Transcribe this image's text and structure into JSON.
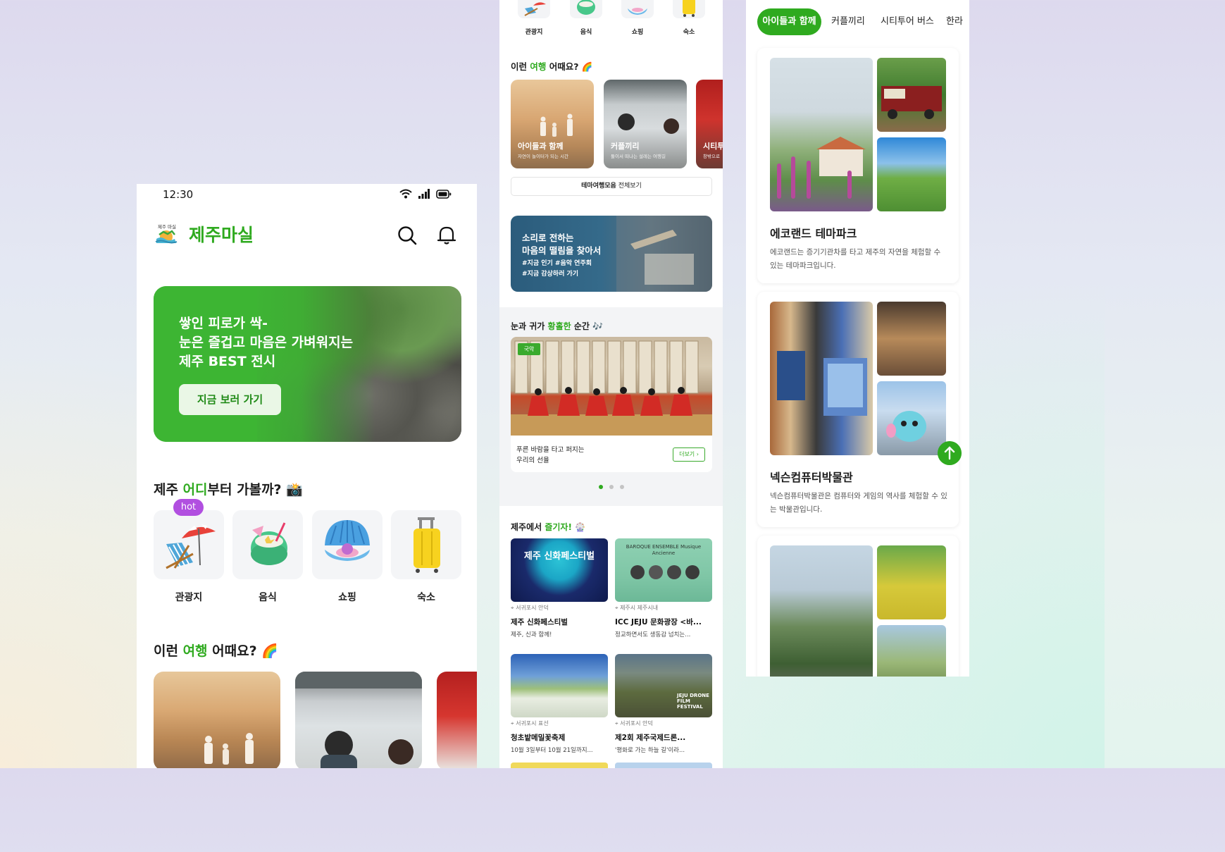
{
  "colors": {
    "brand_green": "#2faa1f",
    "hot_badge": "#b14fe0"
  },
  "screen1": {
    "status": {
      "time": "12:30",
      "icons": [
        "wifi-icon",
        "signal-icon",
        "battery-icon"
      ]
    },
    "app_title": "제주마실",
    "logo_text": "제주 마실",
    "header_icons": [
      "search-icon",
      "bell-icon"
    ],
    "banner": {
      "line1": "쌓인 피로가 싹-",
      "line2": "눈은 즐겁고 마음은 가벼워지는",
      "line3": "제주 BEST 전시",
      "button": "지금 보러 가기"
    },
    "where": {
      "pre": "제주 ",
      "accent": "어디",
      "post": "부터 가볼까? 📸"
    },
    "hot_label": "hot",
    "categories": [
      {
        "label": "관광지",
        "icon": "beach-chair-icon"
      },
      {
        "label": "음식",
        "icon": "coconut-drink-icon"
      },
      {
        "label": "쇼핑",
        "icon": "shell-pearl-icon"
      },
      {
        "label": "숙소",
        "icon": "suitcase-icon"
      }
    ],
    "trip": {
      "pre": "이런 ",
      "accent": "여행",
      "post": " 어때요? 🌈"
    }
  },
  "screen2": {
    "categories": [
      "관광지",
      "음식",
      "쇼핑",
      "숙소"
    ],
    "trip": {
      "pre": "이런 ",
      "accent": "여행",
      "post": " 어때요? 🌈"
    },
    "themes": [
      {
        "title": "아이들과 함께",
        "sub": "자연이 놀이터가 되는 시간"
      },
      {
        "title": "커플끼리",
        "sub": "둘이서 떠나는 설레는 여행길"
      },
      {
        "title": "시티투",
        "sub": "창밖으로"
      }
    ],
    "all_button": {
      "bold": "테마여행모음",
      "rest": " 전체보기"
    },
    "music_banner": {
      "line1": "소리로 전하는",
      "line2": "마음의 떨림을 찾아서",
      "tag1": "#지금 인기  #음악 연주회",
      "tag2": "#지금 감상하러 가기"
    },
    "moment": {
      "pre": "눈과 귀가 ",
      "accent": "황홀한",
      "post": " 순간 🎶"
    },
    "gugak": {
      "badge": "국악",
      "line1": "푸른 바람을 타고 퍼지는",
      "line2": "우리의 선율",
      "more": "더보기 ›"
    },
    "enjoy": {
      "pre": "제주에서 ",
      "accent": "즐기자!",
      "post": " 🎡"
    },
    "festivals": [
      {
        "loc": "서귀포시 안덕",
        "title": "제주 신화페스티벌",
        "sub": "제주, 신과 함께!",
        "poster_text": "제주 신화페스티벌"
      },
      {
        "loc": "제주시 제주시내",
        "title": "ICC JEJU 문화광장 <바...",
        "sub": "정교하면서도 생동감 넘치는...",
        "poster_text": "BAROQUE ENSEMBLE Musique Ancienne"
      },
      {
        "loc": "서귀포시 표선",
        "title": "청초밭메밀꽃축제",
        "sub": "10월 3일부터 10월 21일까지...",
        "poster_text": ""
      },
      {
        "loc": "서귀포시 안덕",
        "title": "제2회 제주국제드론...",
        "sub": "'평화로 가는 하늘 길'이라...",
        "poster_text": "JEJU DRONE FILM FESTIVAL"
      }
    ]
  },
  "screen3": {
    "tabs": [
      "아이들과 함께",
      "커플끼리",
      "시티투어 버스",
      "한라"
    ],
    "places": [
      {
        "title": "에코랜드 테마파크",
        "desc": "에코랜드는 증기기관차를 타고 제주의 자연을 체험할 수 있는 테마파크입니다."
      },
      {
        "title": "넥슨컴퓨터박물관",
        "desc": "넥슨컴퓨터박물관은 컴퓨터와 게임의 역사를 체험할 수 있는 박물관입니다."
      }
    ],
    "fab_icon": "arrow-up-icon"
  }
}
